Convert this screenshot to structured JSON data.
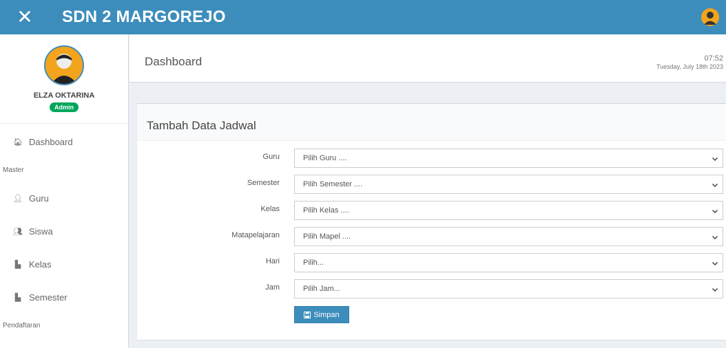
{
  "topbar": {
    "brand": "SDN 2 MARGOREJO",
    "close_icon": "close-icon",
    "avatar_icon": "user-avatar-icon"
  },
  "user": {
    "name": "ELZA OKTARINA",
    "role": "Admin"
  },
  "sidebar": {
    "items": [
      {
        "label": "Dashboard",
        "icon": "home-icon"
      },
      {
        "header": "Master"
      },
      {
        "label": "Guru",
        "icon": "user-icon"
      },
      {
        "label": "Siswa",
        "icon": "users-icon"
      },
      {
        "label": "Kelas",
        "icon": "file-icon"
      },
      {
        "label": "Semester",
        "icon": "file-icon"
      },
      {
        "header": "Pendaftaran"
      }
    ]
  },
  "header": {
    "title": "Dashboard",
    "time": "07:52",
    "date": "Tuesday, July 18th 2023"
  },
  "form": {
    "title": "Tambah Data Jadwal",
    "fields": [
      {
        "label": "Guru",
        "value": "Pilih Guru ...."
      },
      {
        "label": "Semester",
        "value": "Pilih Semester ...."
      },
      {
        "label": "Kelas",
        "value": "Pilih Kelas ...."
      },
      {
        "label": "Matapelajaran",
        "value": "Pilih Mapel ...."
      },
      {
        "label": "Hari",
        "value": "Pilih..."
      },
      {
        "label": "Jam",
        "value": "Pilih Jam..."
      }
    ],
    "submit": "Simpan"
  },
  "colors": {
    "primary": "#3c8dbc",
    "badge": "#00a65a",
    "avatar": "#f2a41c"
  }
}
